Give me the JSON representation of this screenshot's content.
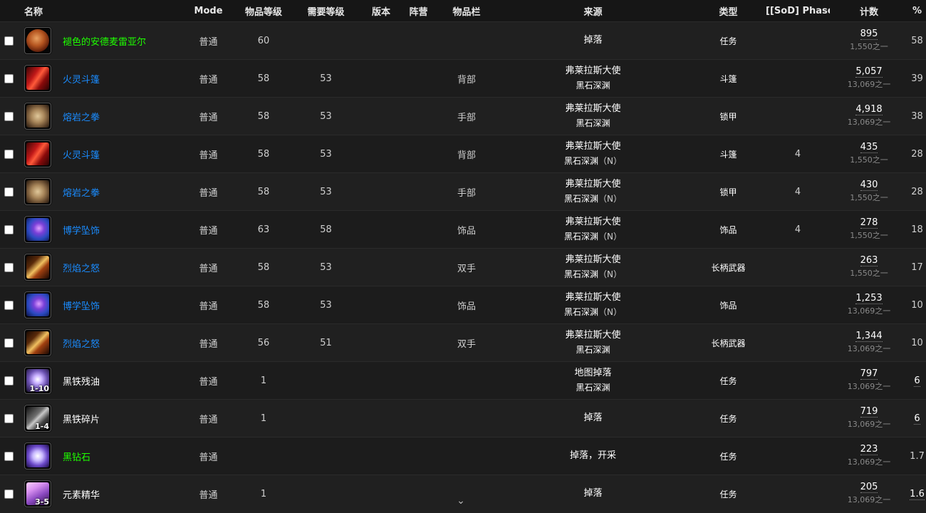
{
  "headers": {
    "name": "名称",
    "mode": "Mode",
    "ilvl": "物品等级",
    "reqlvl": "需要等级",
    "version": "版本",
    "faction": "阵营",
    "slot": "物品栏",
    "source": "来源",
    "type": "类型",
    "phase": "[[SoD] Phase]",
    "count": "计数",
    "pct": "%"
  },
  "rows": [
    {
      "icon": "coin-icon",
      "icon_qty": "",
      "name": "褪色的安德麦雷亚尔",
      "quality": "green",
      "mode": "普通",
      "ilvl": "60",
      "req": "",
      "slot": "",
      "src1": "掉落",
      "src2": "",
      "src2_mode": "",
      "type": "任务",
      "phase": "",
      "count": "895",
      "of": "1,550之一",
      "pct": "58",
      "pct_u": false
    },
    {
      "icon": "cape-icon",
      "icon_qty": "",
      "name": "火灵斗篷",
      "quality": "blue",
      "mode": "普通",
      "ilvl": "58",
      "req": "53",
      "slot": "背部",
      "src1": "弗莱拉斯大使",
      "src2": "黑石深渊",
      "src2_mode": "",
      "type": "斗篷",
      "phase": "",
      "count": "5,057",
      "of": "13,069之一",
      "pct": "39",
      "pct_u": false
    },
    {
      "icon": "fist-icon",
      "icon_qty": "",
      "name": "熔岩之拳",
      "quality": "blue",
      "mode": "普通",
      "ilvl": "58",
      "req": "53",
      "slot": "手部",
      "src1": "弗莱拉斯大使",
      "src2": "黑石深渊",
      "src2_mode": "",
      "type": "锁甲",
      "phase": "",
      "count": "4,918",
      "of": "13,069之一",
      "pct": "38",
      "pct_u": false
    },
    {
      "icon": "cape-icon",
      "icon_qty": "",
      "name": "火灵斗篷",
      "quality": "blue",
      "mode": "普通",
      "ilvl": "58",
      "req": "53",
      "slot": "背部",
      "src1": "弗莱拉斯大使",
      "src2": "黑石深渊",
      "src2_mode": "（N）",
      "type": "斗篷",
      "phase": "4",
      "count": "435",
      "of": "1,550之一",
      "pct": "28",
      "pct_u": false
    },
    {
      "icon": "fist-icon",
      "icon_qty": "",
      "name": "熔岩之拳",
      "quality": "blue",
      "mode": "普通",
      "ilvl": "58",
      "req": "53",
      "slot": "手部",
      "src1": "弗莱拉斯大使",
      "src2": "黑石深渊",
      "src2_mode": "（N）",
      "type": "锁甲",
      "phase": "4",
      "count": "430",
      "of": "1,550之一",
      "pct": "28",
      "pct_u": false
    },
    {
      "icon": "pendant-icon",
      "icon_qty": "",
      "name": "博学坠饰",
      "quality": "blue",
      "mode": "普通",
      "ilvl": "63",
      "req": "58",
      "slot": "饰品",
      "src1": "弗莱拉斯大使",
      "src2": "黑石深渊",
      "src2_mode": "（N）",
      "type": "饰品",
      "phase": "4",
      "count": "278",
      "of": "1,550之一",
      "pct": "18",
      "pct_u": false
    },
    {
      "icon": "polearm-icon",
      "icon_qty": "",
      "name": "烈焰之怒",
      "quality": "blue",
      "mode": "普通",
      "ilvl": "58",
      "req": "53",
      "slot": "双手",
      "src1": "弗莱拉斯大使",
      "src2": "黑石深渊",
      "src2_mode": "（N）",
      "type": "长柄武器",
      "phase": "",
      "count": "263",
      "of": "1,550之一",
      "pct": "17",
      "pct_u": false
    },
    {
      "icon": "pendant-icon",
      "icon_qty": "",
      "name": "博学坠饰",
      "quality": "blue",
      "mode": "普通",
      "ilvl": "58",
      "req": "53",
      "slot": "饰品",
      "src1": "弗莱拉斯大使",
      "src2": "黑石深渊",
      "src2_mode": "（N）",
      "type": "饰品",
      "phase": "",
      "count": "1,253",
      "of": "13,069之一",
      "pct": "10",
      "pct_u": false
    },
    {
      "icon": "polearm-icon",
      "icon_qty": "",
      "name": "烈焰之怒",
      "quality": "blue",
      "mode": "普通",
      "ilvl": "56",
      "req": "51",
      "slot": "双手",
      "src1": "弗莱拉斯大使",
      "src2": "黑石深渊",
      "src2_mode": "",
      "type": "长柄武器",
      "phase": "",
      "count": "1,344",
      "of": "13,069之一",
      "pct": "10",
      "pct_u": false
    },
    {
      "icon": "oil-icon",
      "icon_qty": "1-10",
      "name": "黑铁残油",
      "quality": "white",
      "mode": "普通",
      "ilvl": "1",
      "req": "",
      "slot": "",
      "src1": "地图掉落",
      "src2": "黑石深渊",
      "src2_mode": "",
      "type": "任务",
      "phase": "",
      "count": "797",
      "of": "13,069之一",
      "pct": "6",
      "pct_u": true
    },
    {
      "icon": "shard-icon",
      "icon_qty": "1-4",
      "name": "黑铁碎片",
      "quality": "white",
      "mode": "普通",
      "ilvl": "1",
      "req": "",
      "slot": "",
      "src1": "掉落",
      "src2": "",
      "src2_mode": "",
      "type": "任务",
      "phase": "",
      "count": "719",
      "of": "13,069之一",
      "pct": "6",
      "pct_u": true
    },
    {
      "icon": "gem-icon",
      "icon_qty": "",
      "name": "黑钻石",
      "quality": "green",
      "mode": "普通",
      "ilvl": "",
      "req": "",
      "slot": "",
      "src1": "掉落，开采",
      "src2": "",
      "src2_mode": "",
      "type": "任务",
      "phase": "",
      "count": "223",
      "of": "13,069之一",
      "pct": "1.7",
      "pct_u": false
    },
    {
      "icon": "essence-icon",
      "icon_qty": "3-5",
      "name": "元素精华",
      "quality": "white",
      "mode": "普通",
      "ilvl": "1",
      "req": "",
      "slot": "",
      "src1": "掉落",
      "src2": "",
      "src2_mode": "",
      "type": "任务",
      "phase": "",
      "count": "205",
      "of": "13,069之一",
      "pct": "1.6",
      "pct_u": true
    }
  ],
  "icon_glyphs": {
    "coin-icon": "g-coin",
    "cape-icon": "g-cape",
    "fist-icon": "g-fist",
    "pendant-icon": "g-pend",
    "polearm-icon": "g-axe",
    "oil-icon": "g-oil",
    "shard-icon": "g-shard",
    "gem-icon": "g-gem",
    "essence-icon": "g-ess"
  },
  "scroll_icon": "chevron-down-icon"
}
